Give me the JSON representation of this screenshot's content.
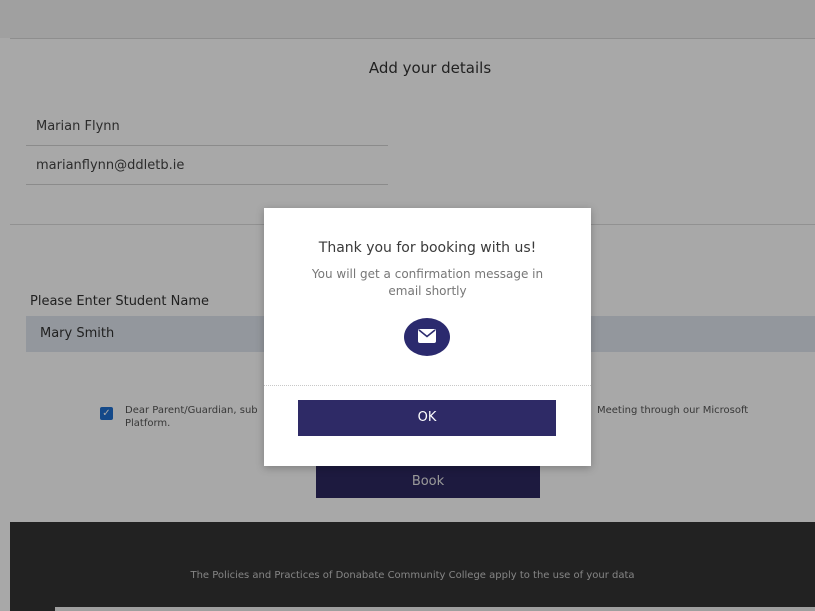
{
  "details": {
    "title": "Add your details",
    "name_value": "Marian Flynn",
    "email_value": "marianflynn@ddletb.ie"
  },
  "student": {
    "label": "Please Enter Student Name",
    "value": "Mary Smith"
  },
  "consent": {
    "checked": true,
    "line1_left": "Dear Parent/Guardian, sub",
    "line1_right": "Meeting through our Microsoft",
    "line2": "Platform."
  },
  "book_label": "Book",
  "footer_text": "The Policies and Practices of Donabate Community College apply to the use of your data",
  "modal": {
    "title": "Thank you for booking with us!",
    "message": "You will get a confirmation message in email shortly",
    "icon": "envelope-icon",
    "ok_label": "OK"
  },
  "colors": {
    "accent": "#2e2a66",
    "footer_bg": "#353535",
    "input_bg": "#dfe6ee",
    "checkbox": "#1f6fd1"
  }
}
